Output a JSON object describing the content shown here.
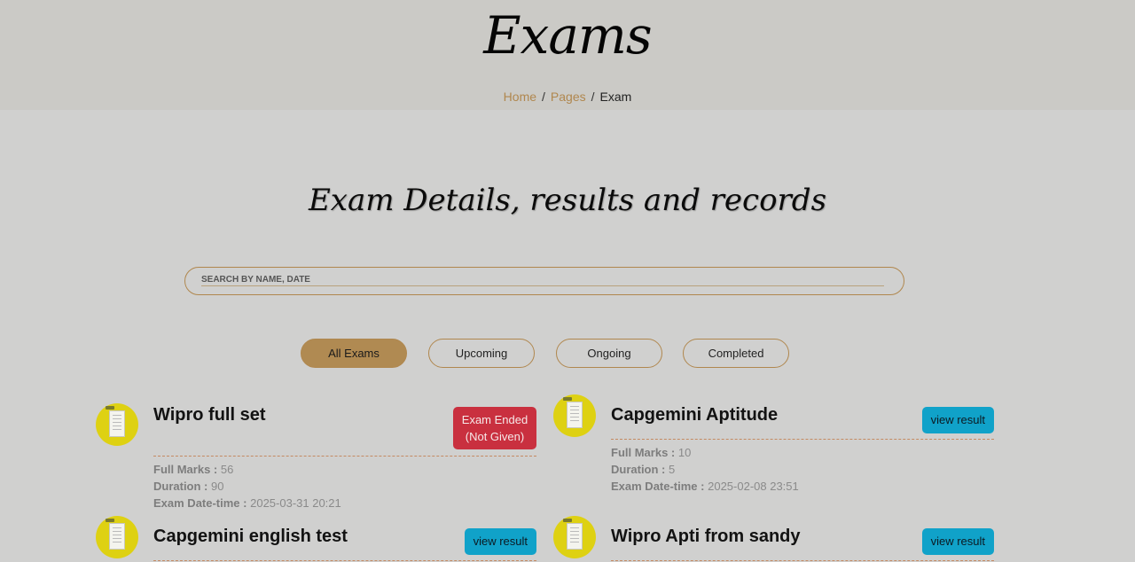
{
  "hero": {
    "title": "Exams",
    "breadcrumb": [
      {
        "label": "Home"
      },
      {
        "label": "Pages"
      },
      {
        "label": "Exam"
      }
    ]
  },
  "section": {
    "title": "Exam Details, results and records"
  },
  "search": {
    "placeholder": "SEARCH BY NAME, DATE",
    "value": ""
  },
  "filters": [
    {
      "label": "All Exams",
      "active": true
    },
    {
      "label": "Upcoming",
      "active": false
    },
    {
      "label": "Ongoing",
      "active": false
    },
    {
      "label": "Completed",
      "active": false
    }
  ],
  "labels": {
    "full_marks": "Full Marks :",
    "duration": "Duration :",
    "exam_datetime": "Exam Date-time :"
  },
  "exams": [
    {
      "name": "Wipro full set",
      "status_line1": "Exam Ended",
      "status_line2": "(Not Given)",
      "full_marks": "56",
      "duration": "90",
      "datetime": "2025-03-31 20:21"
    },
    {
      "name": "Capgemini Aptitude",
      "action": "view result",
      "full_marks": "10",
      "duration": "5",
      "datetime": "2025-02-08 23:51"
    },
    {
      "name": "Capgemini english test",
      "action": "view result"
    },
    {
      "name": "Wipro Apti from sandy",
      "action": "view result"
    }
  ],
  "colors": {
    "accent": "#b0874e",
    "page_bg": "#d0d0cf",
    "hero_bg": "#cbcac6",
    "view_result": "#10a2c9",
    "exam_ended": "#c9303f",
    "avatar": "#ded112"
  }
}
